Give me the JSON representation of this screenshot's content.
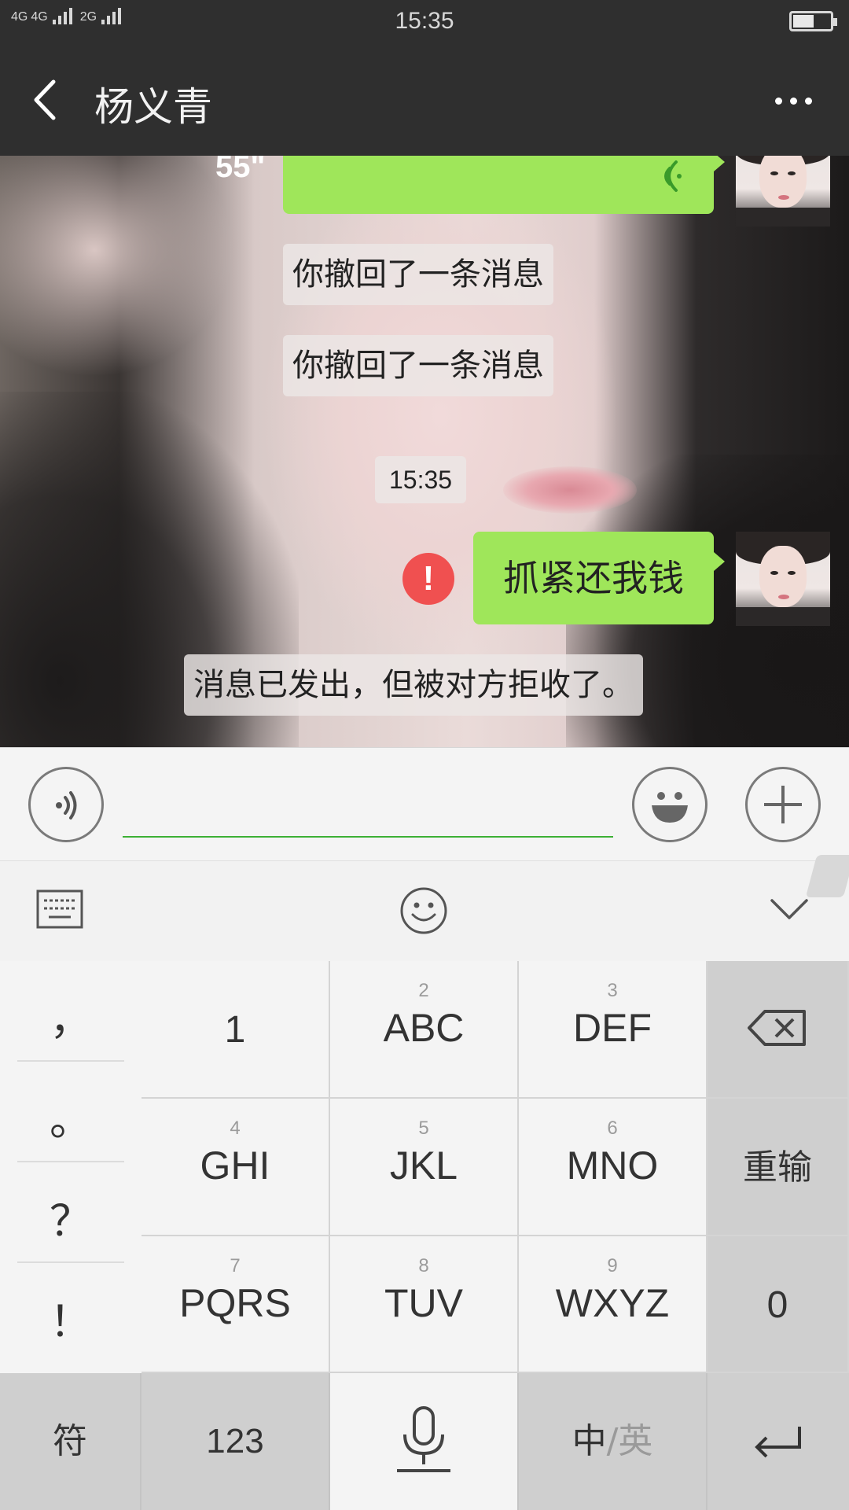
{
  "status_bar": {
    "network_1": "4G",
    "network_2": "4G",
    "network_3": "2G",
    "time": "15:35"
  },
  "header": {
    "title": "杨义青"
  },
  "chat": {
    "voice_message": {
      "duration": "55\""
    },
    "recall_notices": [
      "你撤回了一条消息",
      "你撤回了一条消息"
    ],
    "timestamp": "15:35",
    "sent_message": {
      "text": "抓紧还我钱",
      "status_icon": "!"
    },
    "rejected_notice": "消息已发出，但被对方拒收了。"
  },
  "input_bar": {
    "text_value": ""
  },
  "keyboard": {
    "symbols": [
      "，",
      "。",
      "？",
      "！"
    ],
    "keys": [
      {
        "num": "",
        "label": "1"
      },
      {
        "num": "2",
        "label": "ABC"
      },
      {
        "num": "3",
        "label": "DEF"
      },
      {
        "num": "4",
        "label": "GHI"
      },
      {
        "num": "5",
        "label": "JKL"
      },
      {
        "num": "6",
        "label": "MNO"
      },
      {
        "num": "7",
        "label": "PQRS"
      },
      {
        "num": "8",
        "label": "TUV"
      },
      {
        "num": "9",
        "label": "WXYZ"
      }
    ],
    "reinput_label": "重输",
    "zero_label": "0",
    "symbol_label": "符",
    "num_label": "123",
    "lang_cn": "中",
    "lang_sep": "/",
    "lang_en": "英"
  },
  "colors": {
    "bubble_green": "#9fe65a",
    "header_bg": "#2f2f2f",
    "error_red": "#f05050",
    "input_underline": "#3cb035"
  }
}
